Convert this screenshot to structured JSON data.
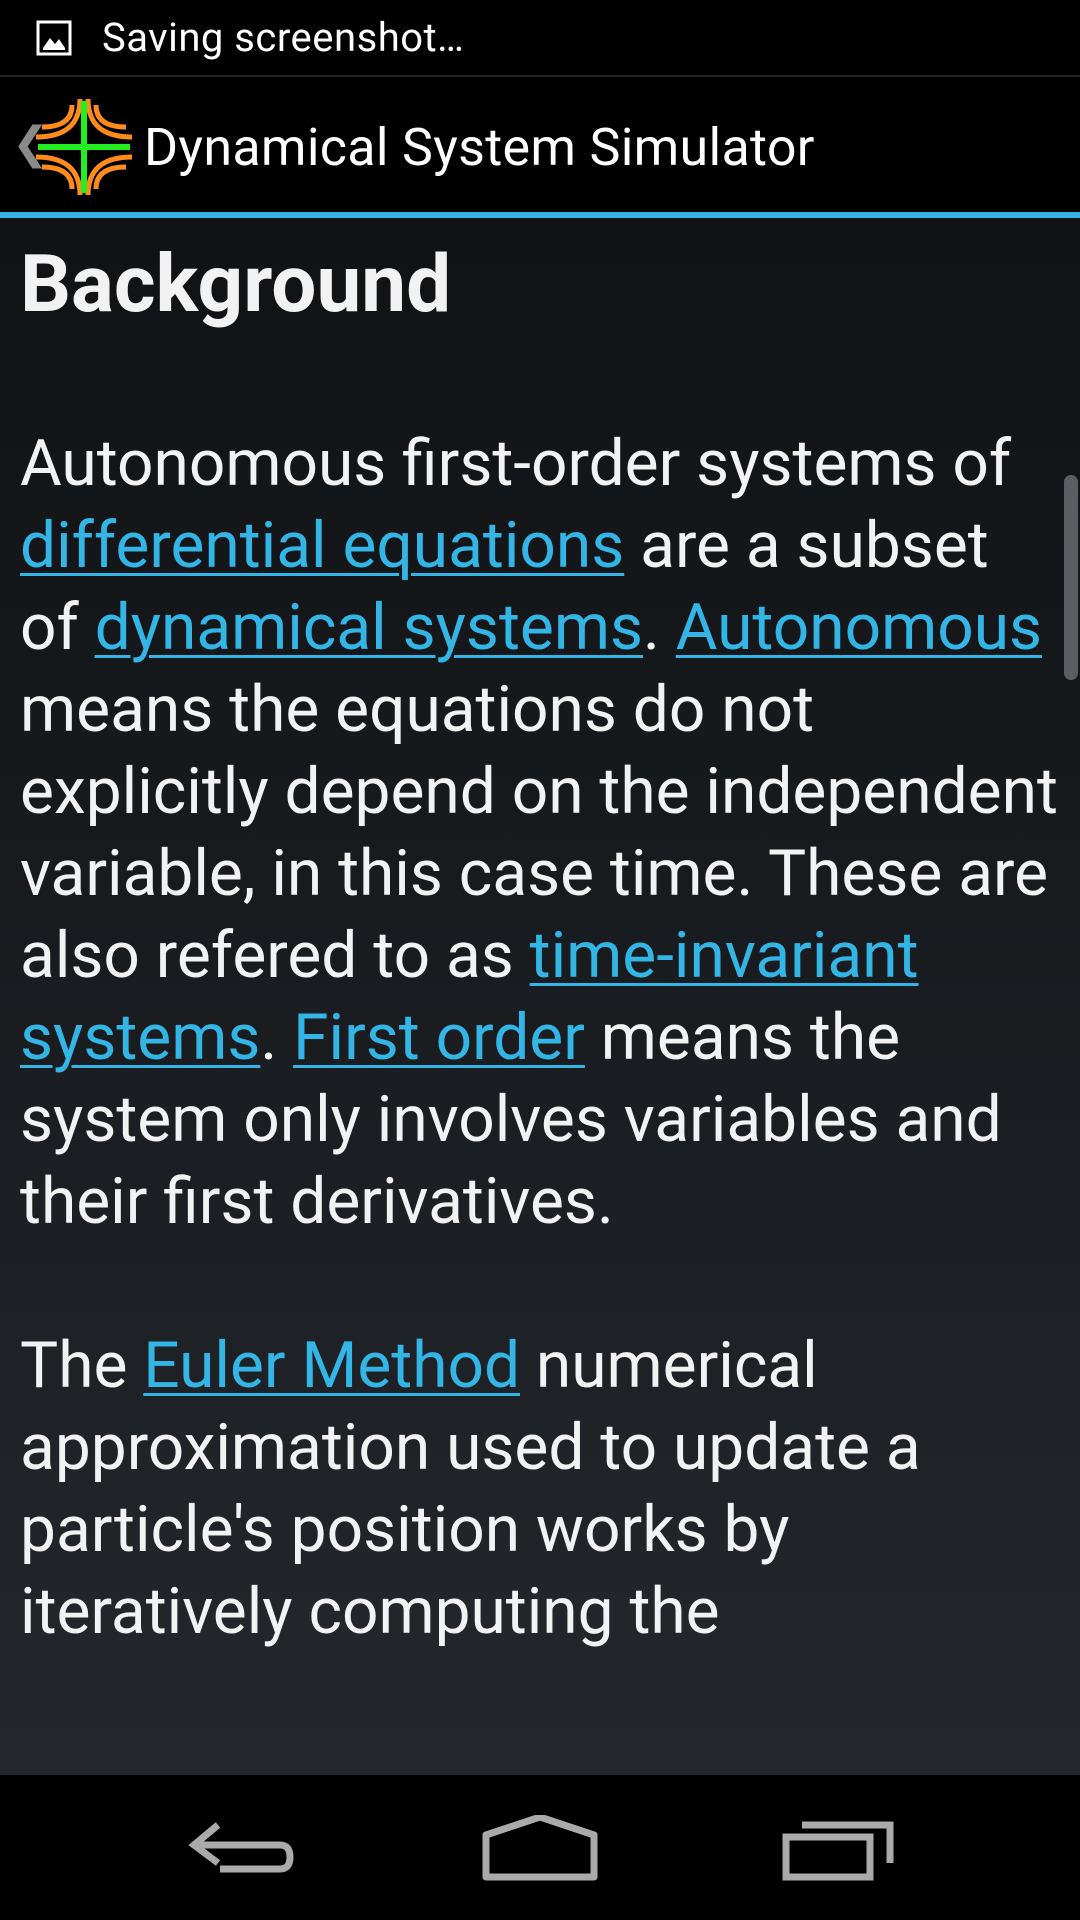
{
  "status_bar": {
    "notification_icon": "image-icon",
    "text": "Saving screenshot…"
  },
  "action_bar": {
    "up_icon": "chevron-left-icon",
    "app_icon": "app-logo-icon",
    "title": "Dynamical System Simulator",
    "accent_color": "#33b5e5"
  },
  "content": {
    "heading": "Background",
    "p1": {
      "t1": "Autonomous first-order systems of ",
      "l1": "differential equations",
      "t2": " are a subset of ",
      "l2": "dynamical systems",
      "t3": ". ",
      "l3": "Autonomous",
      "t4": " means the equations do not explicitly depend on the independent variable, in this case time. These are also refered to as ",
      "l4": "time-invariant systems",
      "t5": ". ",
      "l5": "First order",
      "t6": " means the system only involves variables and their first derivatives."
    },
    "p2": {
      "t1": "The ",
      "l1": "Euler Method",
      "t2": " numerical approximation used to update a particle's position works by iteratively computing the"
    },
    "link_color": "#33b5e5",
    "text_color": "#f2f2f2"
  },
  "nav_bar": {
    "back_icon": "back-icon",
    "home_icon": "home-icon",
    "recents_icon": "recent-apps-icon"
  }
}
